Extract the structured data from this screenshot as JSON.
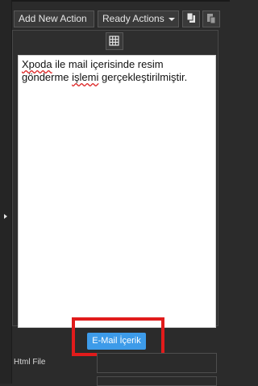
{
  "toolbar": {
    "add_new_action": "Add New Action",
    "ready_actions": "Ready Actions",
    "copy_icon": "copy-icon",
    "paste_icon": "paste-icon",
    "table_icon": "table-icon"
  },
  "editor": {
    "word1": "Xpoda",
    "text1": " ile mail içerisinde resim gönderme ",
    "word2": "işlemi",
    "text2": " gerçekleştirilmiştir."
  },
  "email_button": {
    "label": "E-Mail İçerik"
  },
  "html_file": {
    "label": "Html File",
    "value": ""
  },
  "colors": {
    "background": "#2b2b2b",
    "button_primary": "#3d9be9",
    "highlight": "#e11b1b",
    "editor_bg": "#ffffff"
  }
}
